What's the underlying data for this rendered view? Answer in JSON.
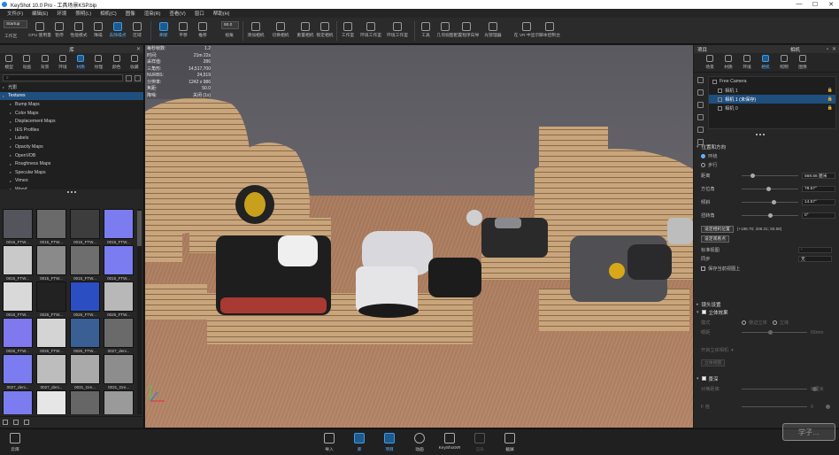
{
  "window": {
    "title": "KeyShot 10.0 Pro - 工具场景KSP.bip",
    "min": "—",
    "max": "☐",
    "close": "✕"
  },
  "menu": [
    "文件(F)",
    "编辑(E)",
    "环境",
    "照明(L)",
    "相机(C)",
    "图像",
    "渲染(R)",
    "查看(V)",
    "窗口",
    "帮助(H)"
  ],
  "toolbar": {
    "workspace_value": "Startup",
    "workspace_label": "工作区",
    "cpu_label": "CPU 使用量",
    "pause_label": "暂停",
    "perf_label": "性能模式",
    "denoise_label": "降噪",
    "gpu_label": "去除噪点",
    "region_label": "区域",
    "refresh_label": "刷新",
    "pan_label": "平移",
    "push_label": "推移",
    "zoom_value": "50.0",
    "fov_label": "视角",
    "add_cam_label": "添加相机",
    "reset_cam_label": "切换相机",
    "lock_cam_label": "重置相机",
    "tumble_label": "锁定相机",
    "studio_label": "工作室",
    "tools_label": "工具",
    "geometry_label": "几何视图",
    "config_label": "配置程序向导",
    "lightmgr_label": "光管理器",
    "vr_label": "在 VR 中显示",
    "script_label": "脚本控制台",
    "env_label": "环境工作室"
  },
  "left_panel": {
    "title": "库",
    "tabs": [
      "模型",
      "动画",
      "背景",
      "环境",
      "材质",
      "纹理",
      "颜色",
      "收藏"
    ],
    "active_tab": 4,
    "search_placeholder": "",
    "tree": [
      {
        "label": "光影",
        "sel": false,
        "indent": 0
      },
      {
        "label": "Textures",
        "sel": true,
        "indent": 0
      },
      {
        "label": "Bump Maps",
        "sel": false,
        "indent": 1
      },
      {
        "label": "Color Maps",
        "sel": false,
        "indent": 1
      },
      {
        "label": "Displacement Maps",
        "sel": false,
        "indent": 1
      },
      {
        "label": "IES Profiles",
        "sel": false,
        "indent": 1
      },
      {
        "label": "Labels",
        "sel": false,
        "indent": 1
      },
      {
        "label": "Opacity Maps",
        "sel": false,
        "indent": 1
      },
      {
        "label": "OpenVDB",
        "sel": false,
        "indent": 1
      },
      {
        "label": "Roughness Maps",
        "sel": false,
        "indent": 1
      },
      {
        "label": "Specular Maps",
        "sel": false,
        "indent": 1
      },
      {
        "label": "Vimeo",
        "sel": false,
        "indent": 1
      },
      {
        "label": "Wood",
        "sel": false,
        "indent": 1
      }
    ],
    "thumbs": [
      {
        "cap": "0016_FTW...",
        "c": "#54545c"
      },
      {
        "cap": "0016_FTW...",
        "c": "#6a6a6a"
      },
      {
        "cap": "0016_FTW...",
        "c": "#3d3d3d"
      },
      {
        "cap": "0016_FTW...",
        "c": "#7b7cf0"
      },
      {
        "cap": "0015_FTW...",
        "c": "#c9c9c9"
      },
      {
        "cap": "0015_FTW...",
        "c": "#8a8a8a"
      },
      {
        "cap": "0015_FTW...",
        "c": "#6e6e6e"
      },
      {
        "cap": "0015_FTW...",
        "c": "#7b7cf0"
      },
      {
        "cap": "0015_FTW...",
        "c": "#d9d9d9"
      },
      {
        "cap": "0026_FTW...",
        "c": "#222222"
      },
      {
        "cap": "0026_FTW...",
        "c": "#2b4fc2"
      },
      {
        "cap": "0026_FTW...",
        "c": "#b8b8b8"
      },
      {
        "cap": "0026_FTW...",
        "c": "#7f78ef"
      },
      {
        "cap": "0026_FTW...",
        "c": "#d4d4d4"
      },
      {
        "cap": "0026_FTW...",
        "c": "#3a5f95"
      },
      {
        "cap": "0027_deni...",
        "c": "#6a6a6a"
      },
      {
        "cap": "0027_deni...",
        "c": "#7b7cf0"
      },
      {
        "cap": "0027_deni...",
        "c": "#bdbdbd"
      },
      {
        "cap": "0031_Gre...",
        "c": "#aaaaaa"
      },
      {
        "cap": "0031_Gre...",
        "c": "#8d8d8d"
      },
      {
        "cap": "",
        "c": "#7b7cf0"
      },
      {
        "cap": "",
        "c": "#e6e6e6"
      },
      {
        "cap": "",
        "c": "#666666"
      },
      {
        "cap": "",
        "c": "#9a9a9a"
      }
    ]
  },
  "stats": [
    [
      "每秒帧数:",
      "1.2"
    ],
    [
      "时间:",
      "21m 22s"
    ],
    [
      "采样值:",
      "286"
    ],
    [
      "三角形:",
      "14,517,700"
    ],
    [
      "NURBS:",
      "24,519"
    ],
    [
      "分辨率:",
      "1242 x 986"
    ],
    [
      "焦距:",
      "50.0"
    ],
    [
      "降噪:",
      "关闭 (1x)"
    ]
  ],
  "right_panel": {
    "project_title": "项目",
    "camera_title": "相机",
    "tabs": [
      "场景",
      "材质",
      "环境",
      "相机",
      "照明",
      "图像"
    ],
    "active_tab": 3,
    "cameras": [
      {
        "label": "Free Camera",
        "sel": false
      },
      {
        "label": "相机 1",
        "sel": false
      },
      {
        "label": "相机 1 (未保存)",
        "sel": true
      },
      {
        "label": "相机 0",
        "sel": false
      }
    ],
    "pos_section": "位置和方向",
    "orbit": "环绕",
    "walk": "步行",
    "distance_label": "距离",
    "distance_val": "568.56 厘米",
    "azimuth_label": "方位角",
    "azimuth_val": "78.57°",
    "incl_label": "倾斜",
    "incl_val": "14.57°",
    "twist_label": "扭转角",
    "twist_val": "0°",
    "set_pivot": "设定相机位置",
    "pivot_info": "(+198.70; 336.31; 83.58)",
    "set_look": "设定观看点",
    "std_view": "标准视图",
    "std_val": "-",
    "sync": "同步",
    "sync_val": "无",
    "keep_level": "保存当前视图上",
    "lens_section": "镜头设置",
    "stereo_section": "立体效果",
    "mode_label": "模式",
    "mode_a": "旁边立体",
    "mode_b": "立体",
    "eye_label": "眼距",
    "eye_val": "65mm",
    "stereo_fx": "开启立体相机",
    "hide": "立体视图",
    "dof_section": "景深",
    "focus_label": "对焦距离",
    "focus_val": "0 厘米",
    "fstop_label": "F 值",
    "fstop_val": "9"
  },
  "bottom": {
    "cloud": "云库",
    "import": "导入",
    "library": "库",
    "project": "项目",
    "animation": "动画",
    "keyshotxr": "KeyShotXR",
    "render": "渲染",
    "screenshot": "截屏",
    "watermark": "学子…"
  }
}
